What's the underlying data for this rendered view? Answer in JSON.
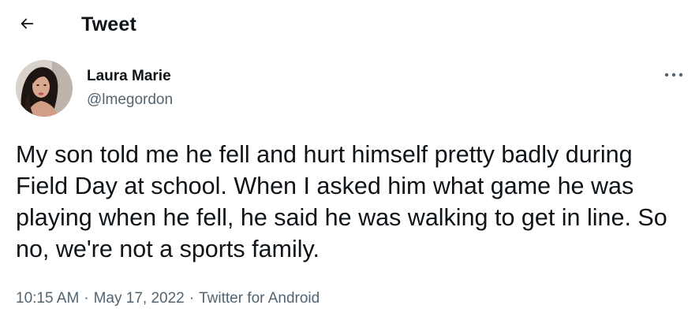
{
  "header": {
    "back_icon": "arrow-left-icon",
    "title": "Tweet"
  },
  "tweet": {
    "author": {
      "name": "Laura Marie",
      "handle": "@lmegordon",
      "avatar_icon": "profile-photo"
    },
    "more_icon": "more-horizontal-icon",
    "text": "My son told me he fell and hurt himself pretty badly during Field Day at school. When I asked him what game he was playing when he fell, he said he was walking to get in line. So no, we're not a sports family.",
    "meta": {
      "time": "10:15 AM",
      "date": "May 17, 2022",
      "source": "Twitter for Android",
      "separator": "·"
    }
  },
  "colors": {
    "text_primary": "#0f1419",
    "text_secondary": "#536471",
    "background": "#ffffff"
  }
}
